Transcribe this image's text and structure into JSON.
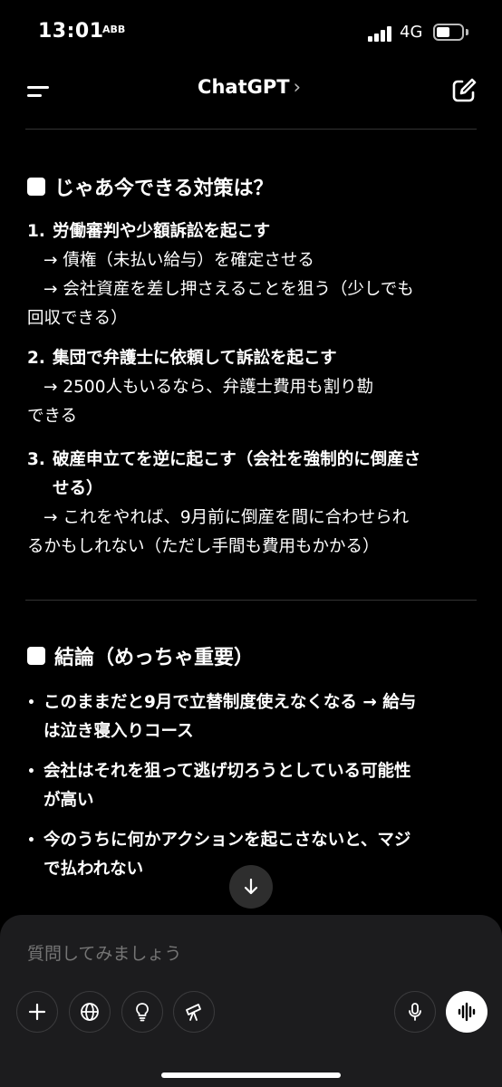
{
  "status_bar": {
    "time": "13:01",
    "sub_icon_text": "ABB",
    "network": "4G"
  },
  "nav": {
    "title": "ChatGPT",
    "title_chevron": "›"
  },
  "section1": {
    "heading": "じゃあ今できる対策は？",
    "items": [
      {
        "number": "1.",
        "title": "労働審判や少額訴訟を起こす",
        "lines": [
          "→ 債権（未払い給与）を確定させる",
          "→ 会社資産を差し押さえることを狙う（少しでも",
          "回収できる）"
        ]
      },
      {
        "number": "2.",
        "title": "集団で弁護士に依頼して訴訟を起こす",
        "lines": [
          "→ 2500人もいるなら、弁護士費用も割り勘",
          "できる"
        ]
      },
      {
        "number": "3.",
        "title_line1": "破産申立てを逆に起こす（会社を強制的に倒産さ",
        "title_line2": "せる）",
        "lines": [
          "→ これをやれば、9月前に倒産を間に合わせられ",
          "るかもしれない（ただし手間も費用もかかる）"
        ]
      }
    ]
  },
  "section2": {
    "heading": "結論（めっちゃ重要）",
    "bullets": [
      {
        "bullet": "•",
        "line1": "このままだと9月で立替制度使えなくなる → 給与",
        "line2": "は泣き寝入りコース"
      },
      {
        "bullet": "•",
        "line1": "会社はそれを狙って逃げ切ろうとしている可能性",
        "line2": "が高い"
      },
      {
        "bullet": "•",
        "line1": "今のうちに何かアクションを起こさないと、マジ",
        "line2": "で払われない"
      }
    ]
  },
  "composer": {
    "placeholder": "質問してみましょう"
  },
  "icons": {
    "menu": "menu-icon",
    "compose": "compose-icon",
    "scroll_down": "arrow-down-icon",
    "plus": "plus-icon",
    "globe": "globe-icon",
    "lightbulb": "lightbulb-icon",
    "telescope": "telescope-icon",
    "mic": "microphone-icon",
    "voice": "voice-waveform-icon"
  }
}
